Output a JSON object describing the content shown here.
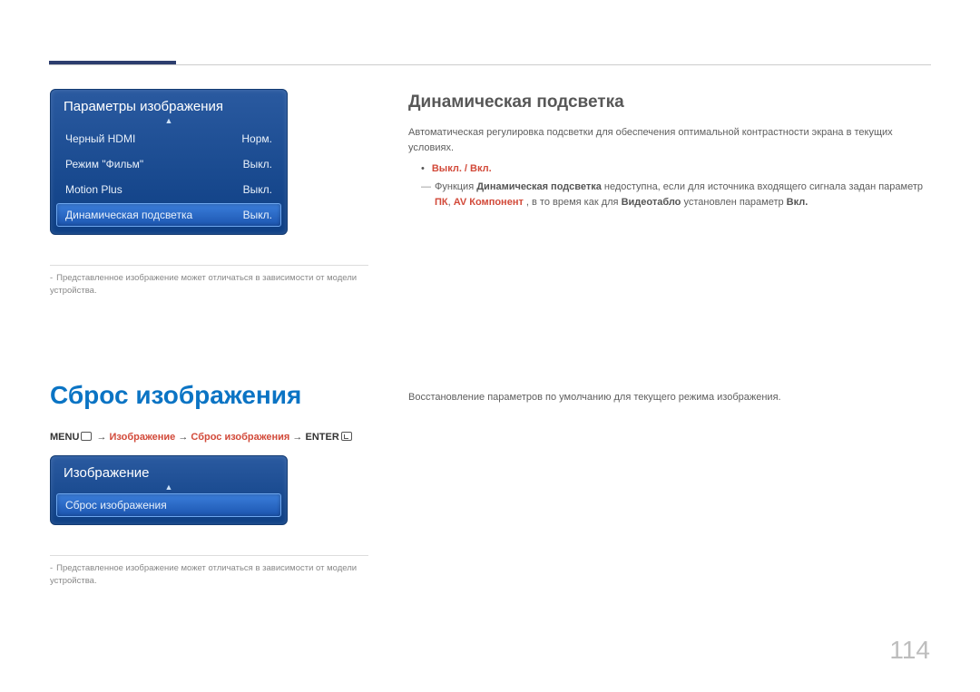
{
  "page_number": "114",
  "panel1": {
    "title": "Параметры изображения",
    "items": [
      {
        "label": "Черный HDMI",
        "value": "Норм."
      },
      {
        "label": "Режим \"Фильм\"",
        "value": "Выкл."
      },
      {
        "label": "Motion Plus",
        "value": "Выкл."
      },
      {
        "label": "Динамическая подсветка",
        "value": "Выкл."
      }
    ]
  },
  "caption1": "Представленное изображение может отличаться в зависимости от модели устройства.",
  "right": {
    "heading": "Динамическая подсветка",
    "p1": "Автоматическая регулировка подсветки для обеспечения оптимальной контрастности экрана в текущих условиях.",
    "options": "Выкл. / Вкл.",
    "note_pre": "Функция ",
    "note_bold1": "Динамическая подсветка",
    "note_mid1": " недоступна, если для источника входящего сигнала задан параметр ",
    "note_red1": "ПК",
    "note_sep1": ", ",
    "note_red2": "AV Компонент",
    "note_mid2": " , в то время как для ",
    "note_bold2": "Видеотабло",
    "note_mid3": " установлен параметр ",
    "note_bold3": "Вкл.",
    "note_end": ""
  },
  "section2": {
    "heading": "Сброс изображения",
    "body": "Восстановление параметров по умолчанию для текущего режима изображения.",
    "nav_menu": "MENU",
    "nav_arrow": " → ",
    "nav_item1": "Изображение",
    "nav_item2": "Сброс изображения",
    "nav_enter": "ENTER"
  },
  "panel2": {
    "title": "Изображение",
    "items": [
      {
        "label": "Сброс изображения",
        "value": ""
      }
    ]
  },
  "caption2": "Представленное изображение может отличаться в зависимости от модели устройства."
}
